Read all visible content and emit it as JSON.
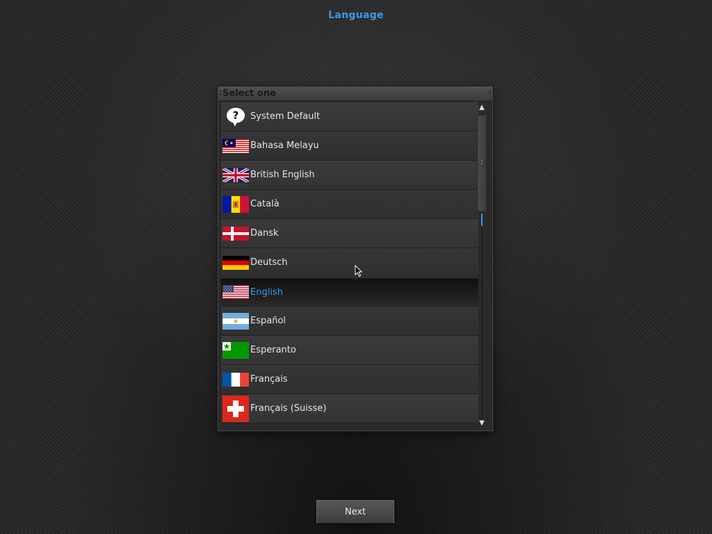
{
  "page": {
    "title": "Language"
  },
  "panel": {
    "header": "Select one",
    "items": [
      {
        "label": "System Default",
        "icon": "help-icon"
      },
      {
        "label": "Bahasa Melayu",
        "icon": "flag-malaysia-icon"
      },
      {
        "label": "British English",
        "icon": "flag-uk-icon"
      },
      {
        "label": "Català",
        "icon": "flag-andorra-icon"
      },
      {
        "label": "Dansk",
        "icon": "flag-denmark-icon"
      },
      {
        "label": "Deutsch",
        "icon": "flag-germany-icon"
      },
      {
        "label": "English",
        "icon": "flag-usa-icon",
        "selected": true
      },
      {
        "label": "Español",
        "icon": "flag-argentina-icon"
      },
      {
        "label": "Esperanto",
        "icon": "flag-esperanto-icon"
      },
      {
        "label": "Français",
        "icon": "flag-france-icon"
      },
      {
        "label": "Français (Suisse)",
        "icon": "flag-switzerland-icon"
      }
    ]
  },
  "footer": {
    "next_label": "Next"
  },
  "colors": {
    "accent": "#3d9be8",
    "text": "#e6e6e6",
    "row_bg": "#363636",
    "selected_row_bg": "#1a1a1a"
  }
}
